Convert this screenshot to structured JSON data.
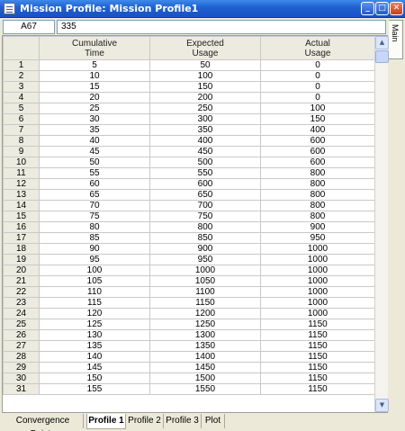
{
  "window": {
    "title": "Mission Profile: Mission Profile1",
    "buttons": {
      "minimize": "_",
      "maximize": "□",
      "close": "✕"
    }
  },
  "refbar": {
    "cell_ref": "A67",
    "cell_value": "335"
  },
  "side_tab": {
    "label": "Main"
  },
  "grid": {
    "headers": [
      {
        "line1": "Cumulative",
        "line2": "Time"
      },
      {
        "line1": "Expected",
        "line2": "Usage"
      },
      {
        "line1": "Actual",
        "line2": "Usage"
      }
    ],
    "rows": [
      [
        "1",
        "5",
        "50",
        "0"
      ],
      [
        "2",
        "10",
        "100",
        "0"
      ],
      [
        "3",
        "15",
        "150",
        "0"
      ],
      [
        "4",
        "20",
        "200",
        "0"
      ],
      [
        "5",
        "25",
        "250",
        "100"
      ],
      [
        "6",
        "30",
        "300",
        "150"
      ],
      [
        "7",
        "35",
        "350",
        "400"
      ],
      [
        "8",
        "40",
        "400",
        "600"
      ],
      [
        "9",
        "45",
        "450",
        "600"
      ],
      [
        "10",
        "50",
        "500",
        "600"
      ],
      [
        "11",
        "55",
        "550",
        "800"
      ],
      [
        "12",
        "60",
        "600",
        "800"
      ],
      [
        "13",
        "65",
        "650",
        "800"
      ],
      [
        "14",
        "70",
        "700",
        "800"
      ],
      [
        "15",
        "75",
        "750",
        "800"
      ],
      [
        "16",
        "80",
        "800",
        "900"
      ],
      [
        "17",
        "85",
        "850",
        "950"
      ],
      [
        "18",
        "90",
        "900",
        "1000"
      ],
      [
        "19",
        "95",
        "950",
        "1000"
      ],
      [
        "20",
        "100",
        "1000",
        "1000"
      ],
      [
        "21",
        "105",
        "1050",
        "1000"
      ],
      [
        "22",
        "110",
        "1100",
        "1000"
      ],
      [
        "23",
        "115",
        "1150",
        "1000"
      ],
      [
        "24",
        "120",
        "1200",
        "1000"
      ],
      [
        "25",
        "125",
        "1250",
        "1150"
      ],
      [
        "26",
        "130",
        "1300",
        "1150"
      ],
      [
        "27",
        "135",
        "1350",
        "1150"
      ],
      [
        "28",
        "140",
        "1400",
        "1150"
      ],
      [
        "29",
        "145",
        "1450",
        "1150"
      ],
      [
        "30",
        "150",
        "1500",
        "1150"
      ],
      [
        "31",
        "155",
        "1550",
        "1150"
      ]
    ]
  },
  "tabs": [
    {
      "label": "Convergence Points",
      "active": false
    },
    {
      "label": "Profile 1",
      "active": true
    },
    {
      "label": "Profile 2",
      "active": false
    },
    {
      "label": "Profile 3",
      "active": false
    },
    {
      "label": "Plot",
      "active": false
    }
  ],
  "colors": {
    "titlebar": "#1f5fd1",
    "header_bg": "#ecebdf",
    "close_button": "#c6401b"
  }
}
